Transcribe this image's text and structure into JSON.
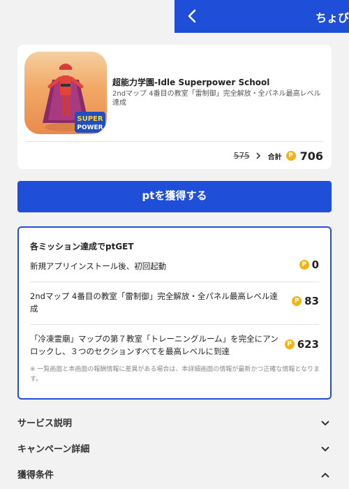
{
  "header": {
    "title": "ちょび",
    "back_icon": "chevron-left-icon"
  },
  "app": {
    "name": "超能力学園-Idle Superpower School",
    "description": "2ndマップ 4番目の教室「雷制御」完全解放・全パネル最高レベル達成",
    "icon_text_1": "SUPER",
    "icon_text_2": "POWER"
  },
  "points": {
    "old": "575",
    "total_label": "合計",
    "coin": "P",
    "total": "706"
  },
  "get_button": {
    "label": "ptを獲得する"
  },
  "missions": {
    "title": "各ミッション達成でptGET",
    "items": [
      {
        "text": "新規アプリインストール後、初回起動",
        "points": "0"
      },
      {
        "text": "2ndマップ 4番目の教室「雷制御」完全解放・全パネル最高レベル達成",
        "points": "83"
      },
      {
        "text": "「冷凍霊廟」マップの第７教室「トレーニングルーム」を完全にアンロックし、３つのセクションすべてを最高レベルに到達",
        "points": "623"
      }
    ],
    "note": "※ 一覧画面と本画面の報酬情報に差異がある場合は、本詳細画面の情報が最新かつ正確な情報となります。"
  },
  "accordions": [
    {
      "label": "サービス説明",
      "state": "collapsed"
    },
    {
      "label": "キャンペーン詳細",
      "state": "collapsed"
    },
    {
      "label": "獲得条件",
      "state": "expanded"
    }
  ],
  "colors": {
    "primary": "#1f4fd8",
    "coin": "#f3b316",
    "background": "#f2f2f2"
  }
}
